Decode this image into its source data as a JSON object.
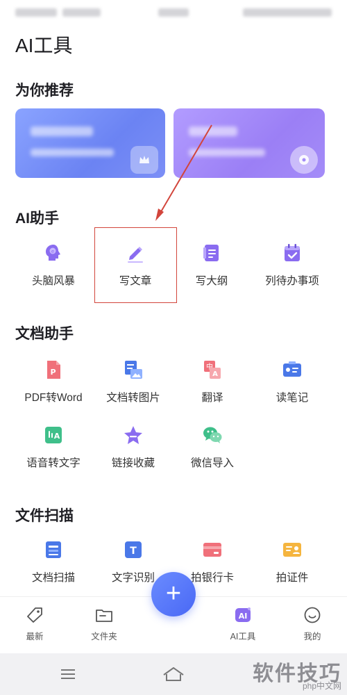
{
  "page": {
    "title": "AI工具"
  },
  "sections": {
    "recommend": "为你推荐",
    "ai_assistant": "AI助手",
    "doc_assistant": "文档助手",
    "file_scan": "文件扫描"
  },
  "ai_tools": [
    {
      "label": "头脑风暴",
      "icon": "brain-icon"
    },
    {
      "label": "写文章",
      "icon": "pencil-icon"
    },
    {
      "label": "写大纲",
      "icon": "outline-icon"
    },
    {
      "label": "列待办事项",
      "icon": "calendar-check-icon"
    }
  ],
  "doc_tools": [
    {
      "label": "PDF转Word",
      "icon": "pdf-icon"
    },
    {
      "label": "文档转图片",
      "icon": "doc-to-image-icon"
    },
    {
      "label": "翻译",
      "icon": "translate-icon"
    },
    {
      "label": "读笔记",
      "icon": "note-card-icon"
    },
    {
      "label": "语音转文字",
      "icon": "voice-to-text-icon"
    },
    {
      "label": "链接收藏",
      "icon": "star-icon"
    },
    {
      "label": "微信导入",
      "icon": "wechat-icon"
    }
  ],
  "scan_tools": [
    {
      "label": "文档扫描",
      "icon": "doc-scan-icon"
    },
    {
      "label": "文字识别",
      "icon": "text-recognition-icon"
    },
    {
      "label": "拍银行卡",
      "icon": "bank-card-icon"
    },
    {
      "label": "拍证件",
      "icon": "id-card-icon"
    }
  ],
  "bottom_nav": [
    {
      "label": "最新",
      "icon": "tag-icon"
    },
    {
      "label": "文件夹",
      "icon": "folder-icon"
    },
    {
      "label": "AI工具",
      "icon": "ai-icon",
      "active": true
    },
    {
      "label": "我的",
      "icon": "smile-face-icon"
    }
  ],
  "fab": {
    "symbol": "+"
  },
  "watermark": {
    "text": "软件技巧",
    "sub": "php中文网"
  },
  "colors": {
    "accent": "#4968f5",
    "ai_purple": "#8a6cf0",
    "highlight": "#d2453b"
  }
}
